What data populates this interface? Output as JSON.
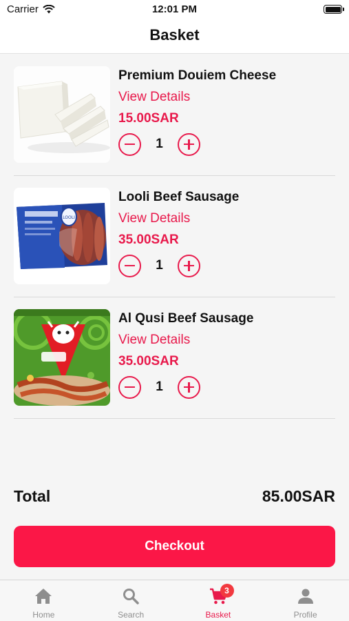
{
  "status_bar": {
    "carrier": "Carrier",
    "time": "12:01 PM"
  },
  "header": {
    "title": "Basket"
  },
  "basket": {
    "items": [
      {
        "name": "Premium Douiem Cheese",
        "details_label": "View Details",
        "price": "15.00SAR",
        "quantity": "1",
        "image": "cheese-image"
      },
      {
        "name": "Looli Beef Sausage",
        "details_label": "View Details",
        "price": "35.00SAR",
        "quantity": "1",
        "image": "sausage-pack-image"
      },
      {
        "name": "Al Qusi Beef Sausage",
        "details_label": "View Details",
        "price": "35.00SAR",
        "quantity": "1",
        "image": "al-qusi-sausage-image"
      }
    ]
  },
  "summary": {
    "total_label": "Total",
    "total_value": "85.00SAR"
  },
  "checkout": {
    "label": "Checkout"
  },
  "tabbar": {
    "tabs": [
      {
        "label": "Home",
        "icon": "home-icon"
      },
      {
        "label": "Search",
        "icon": "search-icon"
      },
      {
        "label": "Basket",
        "icon": "cart-icon",
        "badge": "3",
        "active": true
      },
      {
        "label": "Profile",
        "icon": "person-icon"
      }
    ]
  },
  "colors": {
    "accent": "#e8194b",
    "checkout_button": "#fb1747",
    "badge": "#f2393f",
    "inactive_tab": "#8e8e8e"
  }
}
